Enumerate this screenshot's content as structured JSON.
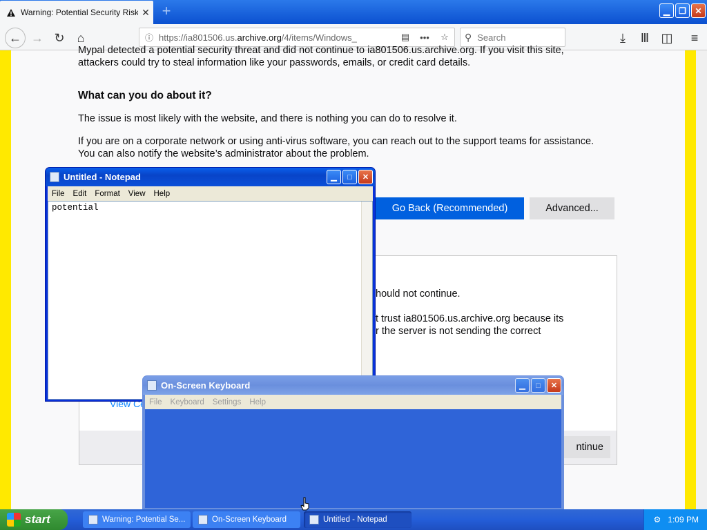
{
  "browser": {
    "tab_title": "Warning: Potential Security Risk Ah",
    "tab_close": "✕",
    "new_tab": "+",
    "url_prefix": "https://ia801506.us.",
    "url_host": "archive.org",
    "url_suffix": "/4/items/Windows_",
    "search_placeholder": "Search",
    "win_minimize": "▁",
    "win_restore": "❐",
    "win_close": "✕"
  },
  "page": {
    "intro_line1": "Mypal detected a potential security threat and did not continue to ia801506.us.archive.org. If you visit this site,",
    "intro_line2": "attackers could try to steal information like your passwords, emails, or credit card details.",
    "heading": "What can you do about it?",
    "p1": "The issue is most likely with the website, and there is nothing you can do to resolve it.",
    "p2_line1": "If you are on a corporate network or using anti-virus software, you can reach out to the support teams for assistance.",
    "p2_line2": "You can also notify the website’s administrator about the problem.",
    "go_back": "Go Back (Recommended)",
    "advanced": "Advanced...",
    "adv_text1": "hould not continue.",
    "adv_text2": "t trust ia801506.us.archive.org because its",
    "adv_text3": "r the server is not sending the correct",
    "view_cert": "View Ce",
    "continue": "ntinue"
  },
  "notepad": {
    "title": "Untitled - Notepad",
    "menu": [
      "File",
      "Edit",
      "Format",
      "View",
      "Help"
    ],
    "content": "potential"
  },
  "osk": {
    "title": "On-Screen Keyboard",
    "menu": [
      "File",
      "Keyboard",
      "Settings",
      "Help"
    ]
  },
  "taskbar": {
    "start": "start",
    "tasks": [
      "Warning: Potential Se...",
      "On-Screen Keyboard",
      "Untitled - Notepad"
    ],
    "clock": "1:09 PM"
  }
}
